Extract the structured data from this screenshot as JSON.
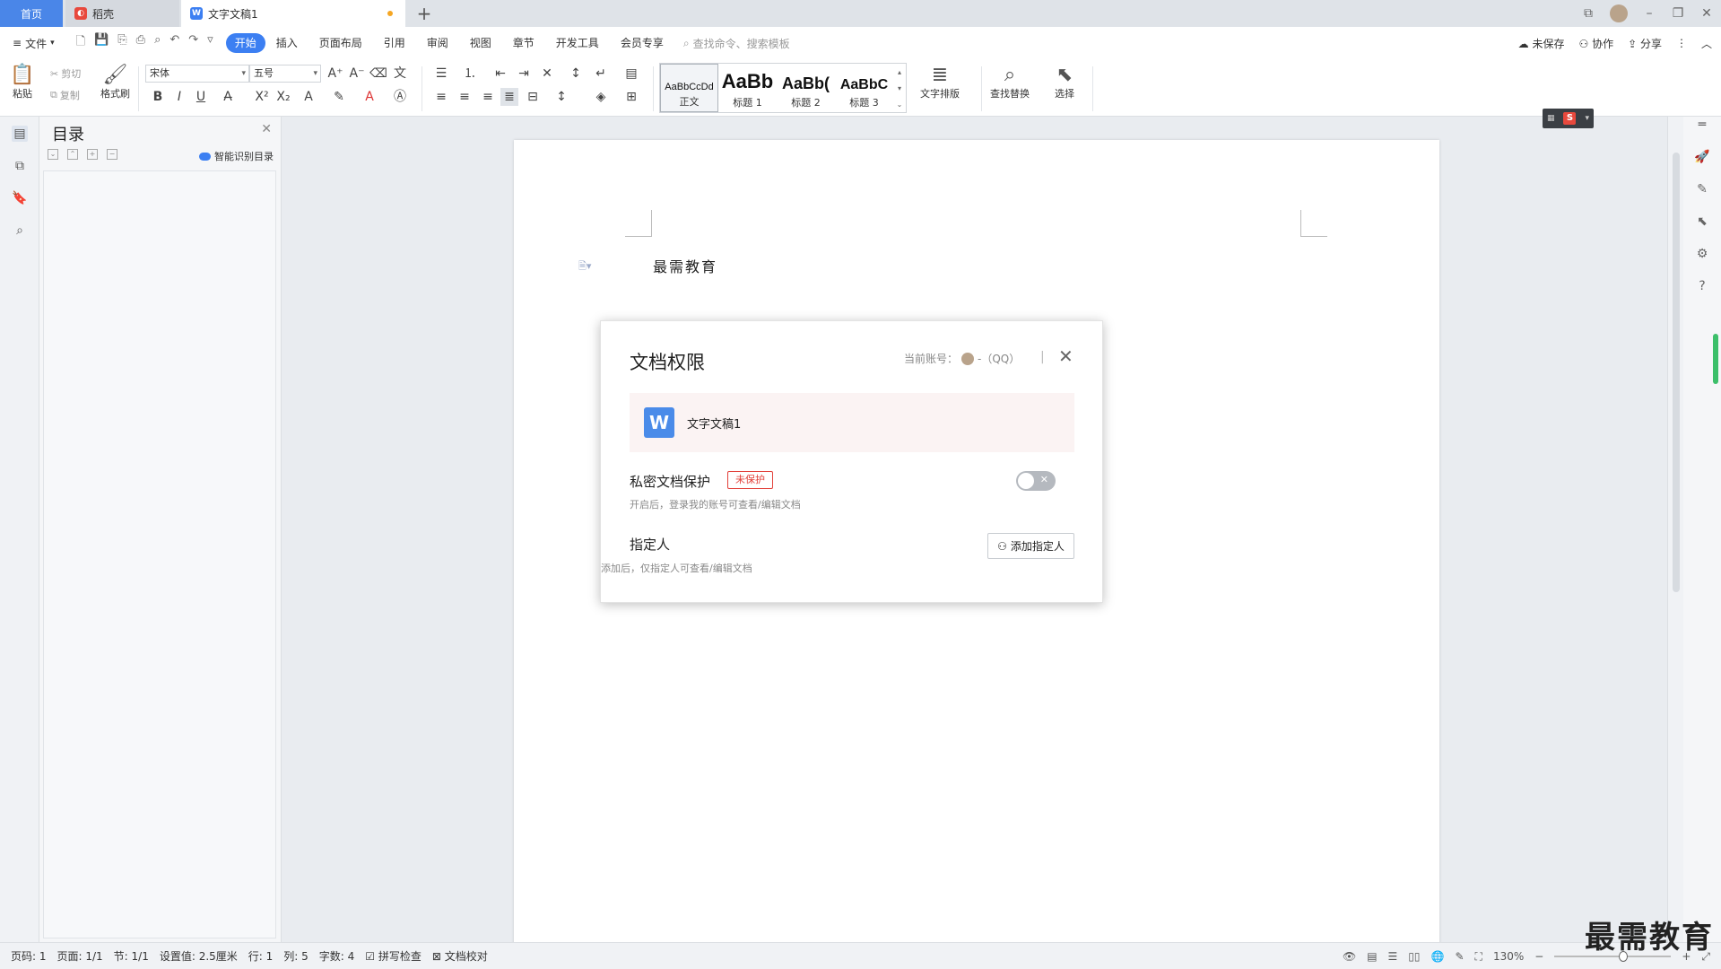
{
  "tabs": {
    "home": "首页",
    "daoke": "稻壳",
    "doc": "文字文稿1",
    "add": "+"
  },
  "menu": {
    "file": "文件",
    "tabs": [
      "开始",
      "插入",
      "页面布局",
      "引用",
      "审阅",
      "视图",
      "章节",
      "开发工具",
      "会员专享"
    ],
    "search_placeholder": "查找命令、搜索模板",
    "unsaved": "未保存",
    "collab": "协作",
    "share": "分享"
  },
  "ribbon": {
    "paste": "粘贴",
    "cut": "剪切",
    "copy": "复制",
    "format_painter": "格式刷",
    "font_name": "宋体",
    "font_size": "五号",
    "styles": [
      {
        "sample": "AaBbCcDd",
        "label": "正文"
      },
      {
        "sample": "AaBb",
        "label": "标题 1"
      },
      {
        "sample": "AaBb(",
        "label": "标题 2"
      },
      {
        "sample": "AaBbC",
        "label": "标题 3"
      }
    ],
    "text_layout": "文字排版",
    "find_replace": "查找替换",
    "select": "选择"
  },
  "toc": {
    "title": "目录",
    "smart": "智能识别目录"
  },
  "document": {
    "text": "最需教育"
  },
  "dialog": {
    "title": "文档权限",
    "account_label": "当前账号：",
    "account_value": "-（QQ）",
    "file_name": "文字文稿1",
    "private_label": "私密文档保护",
    "private_badge": "未保护",
    "private_desc": "开启后，登录我的账号可查看/编辑文档",
    "assignee_label": "指定人",
    "add_assignee": "添加指定人",
    "assignee_desc": "添加后，仅指定人可查看/编辑文档",
    "toggle_on": false
  },
  "status": {
    "page_num": "页码: 1",
    "pages": "页面: 1/1",
    "section": "节: 1/1",
    "setting": "设置值: 2.5厘米",
    "row": "行: 1",
    "col": "列: 5",
    "words": "字数: 4",
    "spell": "拼写检查",
    "proof": "文档校对",
    "zoom": "130%"
  },
  "watermark": "最需教育",
  "colors": {
    "accent": "#3c7ff2",
    "badge_red": "#e2403a"
  }
}
